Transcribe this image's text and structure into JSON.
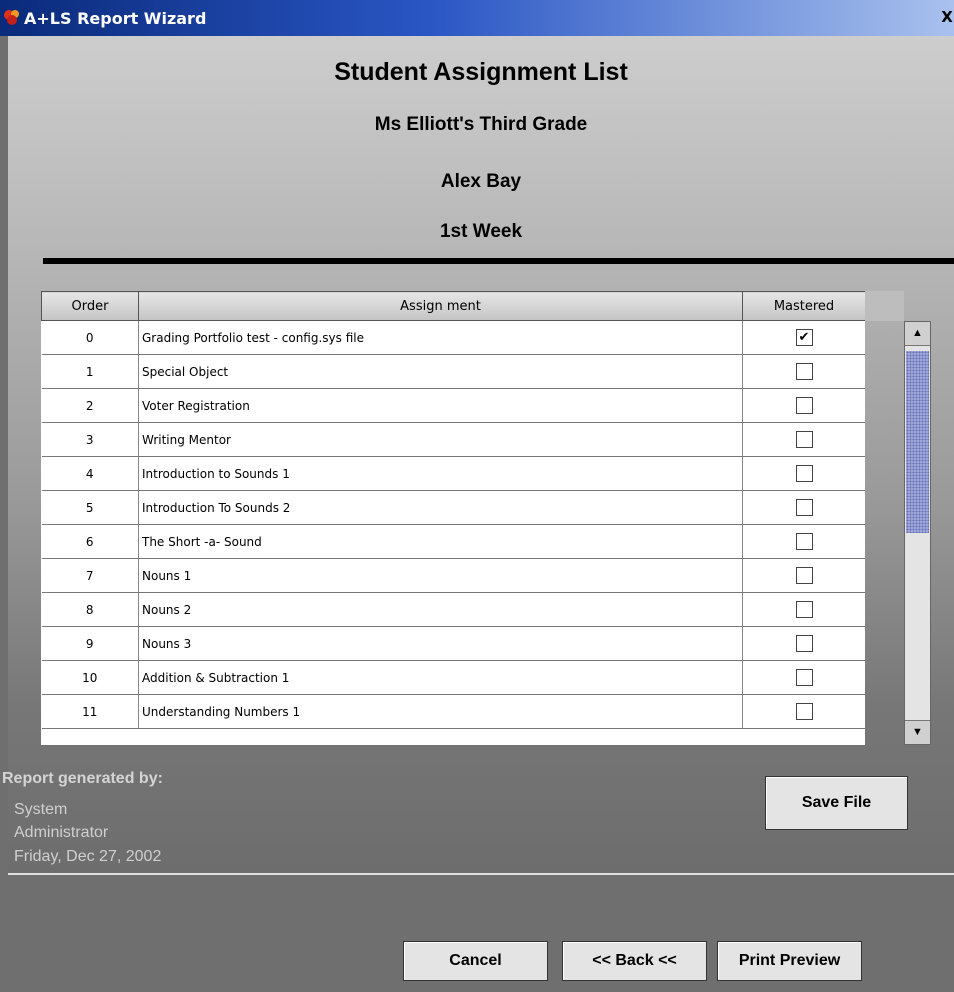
{
  "window": {
    "title": "A+LS Report Wizard",
    "close": "X"
  },
  "report": {
    "title": "Student Assignment List",
    "class": "Ms Elliott's Third Grade",
    "student": "Alex  Bay",
    "week": "1st Week"
  },
  "table": {
    "headers": {
      "order": "Order",
      "assignment": "Assign ment",
      "mastered": "Mastered"
    },
    "rows": [
      {
        "order": "0",
        "assignment": "Grading Portfolio test - config.sys file",
        "mastered": true
      },
      {
        "order": "1",
        "assignment": "Special Object",
        "mastered": false
      },
      {
        "order": "2",
        "assignment": "Voter Registration",
        "mastered": false
      },
      {
        "order": "3",
        "assignment": "Writing Mentor",
        "mastered": false
      },
      {
        "order": "4",
        "assignment": "Introduction to Sounds 1",
        "mastered": false
      },
      {
        "order": "5",
        "assignment": "Introduction To Sounds 2",
        "mastered": false
      },
      {
        "order": "6",
        "assignment": "The Short -a- Sound",
        "mastered": false
      },
      {
        "order": "7",
        "assignment": "Nouns 1",
        "mastered": false
      },
      {
        "order": "8",
        "assignment": "Nouns 2",
        "mastered": false
      },
      {
        "order": "9",
        "assignment": "Nouns 3",
        "mastered": false
      },
      {
        "order": "10",
        "assignment": "Addition & Subtraction 1",
        "mastered": false
      },
      {
        "order": "11",
        "assignment": "Understanding Numbers 1",
        "mastered": false
      }
    ]
  },
  "generated": {
    "label": "Report generated by:",
    "line1": "System",
    "line2": "Administrator",
    "date": "Friday, Dec 27, 2002"
  },
  "buttons": {
    "save_file": "Save File",
    "cancel": "Cancel",
    "back": "<< Back <<",
    "print_preview": "Print Preview"
  },
  "colors": {
    "title_bar": "#2a56c4",
    "scroll_thumb": "#9fa6d9"
  }
}
